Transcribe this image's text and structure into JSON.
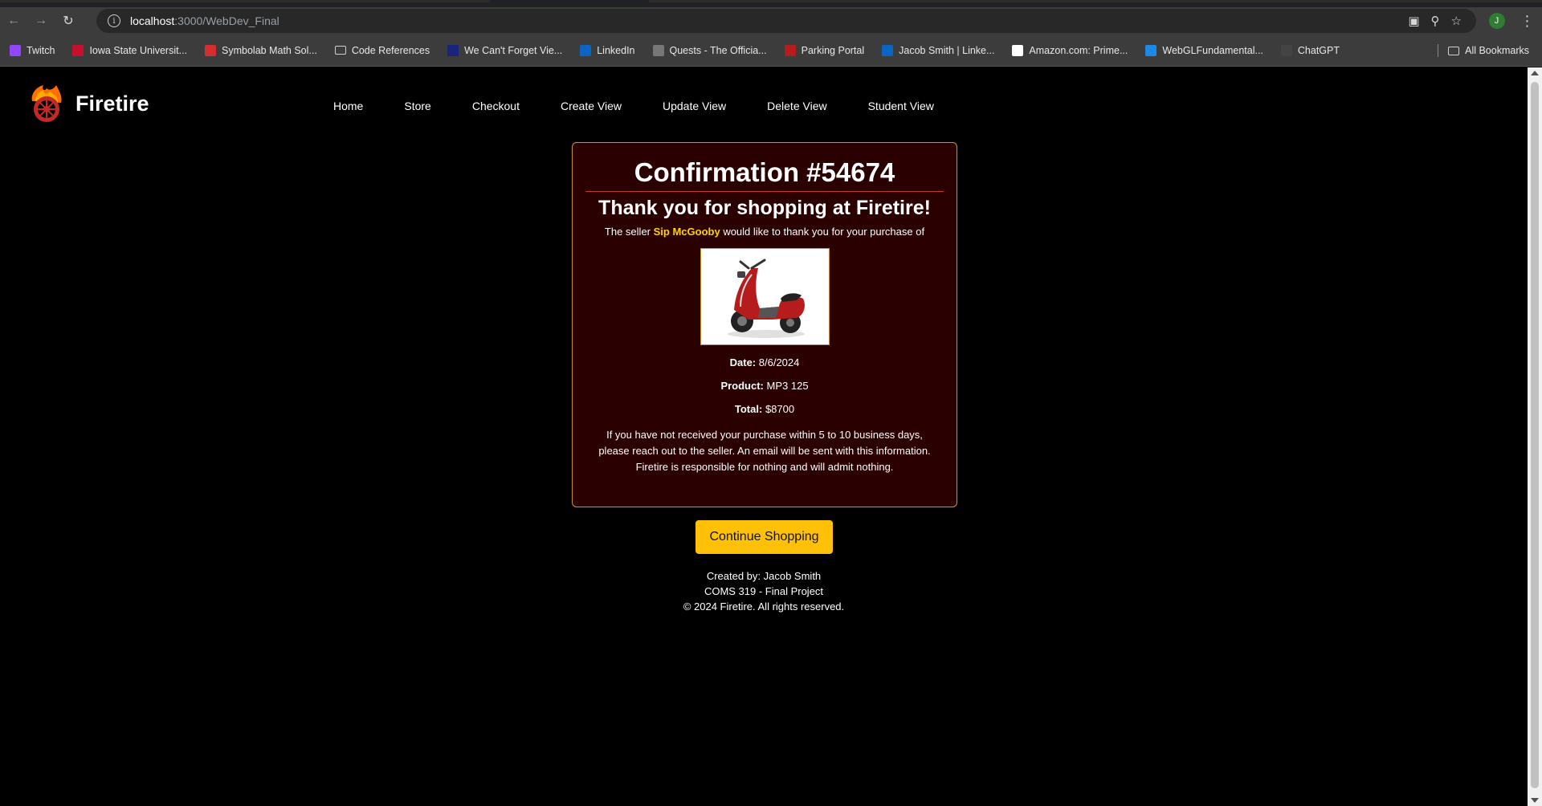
{
  "browser": {
    "url_host": "localhost",
    "url_rest": ":3000/WebDev_Final",
    "profile_initial": "J",
    "bookmarks": [
      {
        "label": "Twitch",
        "icon": "twitch-icon",
        "color": "#9146ff"
      },
      {
        "label": "Iowa State Universit...",
        "icon": "isu-icon",
        "color": "#c8102e"
      },
      {
        "label": "Symbolab Math Sol...",
        "icon": "symbolab-icon",
        "color": "#d32f2f"
      },
      {
        "label": "Code References",
        "icon": "folder-icon",
        "color": ""
      },
      {
        "label": "We Can't Forget Vie...",
        "icon": "site-icon",
        "color": "#1a237e"
      },
      {
        "label": "LinkedIn",
        "icon": "linkedin-icon",
        "color": "#0a66c2"
      },
      {
        "label": "Quests - The Officia...",
        "icon": "quests-icon",
        "color": "#777777"
      },
      {
        "label": "Parking Portal",
        "icon": "parking-icon",
        "color": "#b71c1c"
      },
      {
        "label": "Jacob Smith | Linke...",
        "icon": "linkedin-icon",
        "color": "#0a66c2"
      },
      {
        "label": "Amazon.com: Prime...",
        "icon": "amazon-icon",
        "color": "#ffffff"
      },
      {
        "label": "WebGLFundamental...",
        "icon": "webgl-icon",
        "color": "#1e88e5"
      },
      {
        "label": "ChatGPT",
        "icon": "chatgpt-icon",
        "color": "#444444"
      }
    ],
    "all_bookmarks": "All Bookmarks"
  },
  "site": {
    "name": "Firetire",
    "nav": [
      "Home",
      "Store",
      "Checkout",
      "Create View",
      "Update View",
      "Delete View",
      "Student View"
    ]
  },
  "confirmation": {
    "title": "Confirmation #54674",
    "thanks": "Thank you for shopping at Firetire!",
    "seller_prefix": "The seller",
    "seller_name": "Sip McGooby",
    "seller_suffix": "would like to thank you for your purchase of",
    "date_label": "Date:",
    "date_value": "8/6/2024",
    "product_label": "Product:",
    "product_value": "MP3 125",
    "total_label": "Total:",
    "total_value": "$8700",
    "notice_1": "If you have not received your purchase within 5 to 10 business days, please reach out to the seller. An email will be sent with this information.",
    "notice_2": "Firetire is responsible for nothing and will admit nothing."
  },
  "actions": {
    "continue_label": "Continue Shopping"
  },
  "footer": {
    "created_by": "Created by: Jacob Smith",
    "course": "COMS 319 - Final Project",
    "copyright": "© 2024 Firetire. All rights reserved."
  },
  "colors": {
    "accent": "#ffc107",
    "card_bg": "#2a0000",
    "seller_highlight": "#ffd200"
  }
}
